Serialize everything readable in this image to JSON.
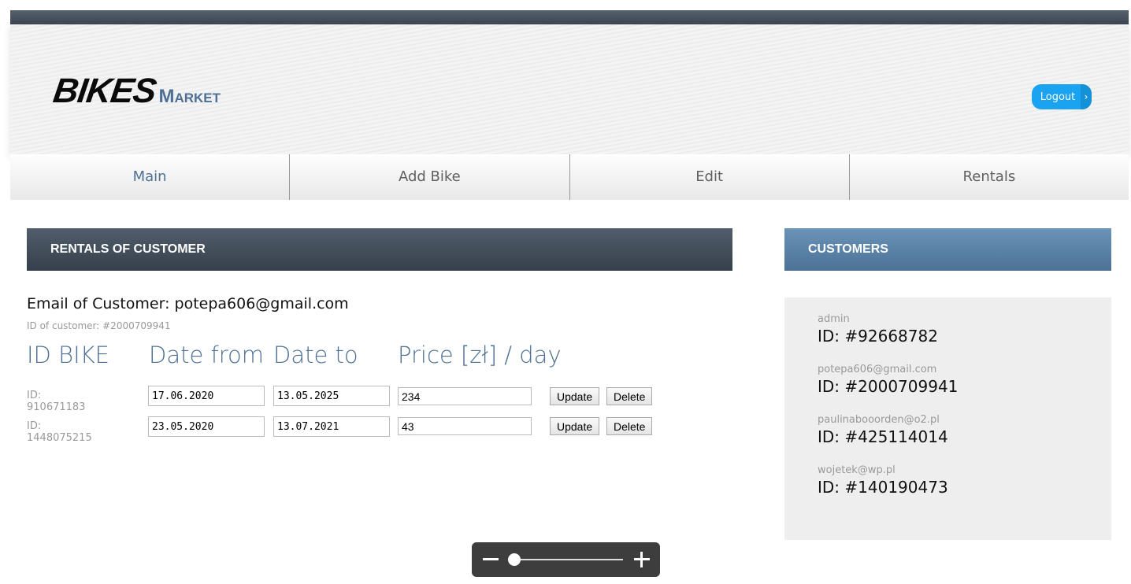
{
  "header": {
    "logo_bold": "BIKES",
    "logo_light": "Market",
    "logout": "Logout"
  },
  "nav": [
    "Main",
    "Add Bike",
    "Edit",
    "Rentals"
  ],
  "rentals": {
    "title": "RENTALS OF CUSTOMER",
    "email_line": "Email of Customer: potepa606@gmail.com",
    "id_line": "ID of customer: #2000709941",
    "columns": [
      "ID BIKE",
      "Date from",
      "Date to",
      "Price [zł] / day"
    ],
    "rows": [
      {
        "bike": "ID: 910671183",
        "from": "17.06.2020",
        "to": "13.05.2025",
        "price": "234"
      },
      {
        "bike": "ID: 1448075215",
        "from": "23.05.2020",
        "to": "13.07.2021",
        "price": "43"
      }
    ],
    "update": "Update",
    "delete": "Delete"
  },
  "customers": {
    "title": "CUSTOMERS",
    "items": [
      {
        "email": "admin",
        "id": "ID: #92668782"
      },
      {
        "email": "potepa606@gmail.com",
        "id": "ID: #2000709941"
      },
      {
        "email": "paulinabooorden@o2.pl",
        "id": "ID: #425114014"
      },
      {
        "email": "wojetek@wp.pl",
        "id": "ID: #140190473"
      }
    ]
  }
}
